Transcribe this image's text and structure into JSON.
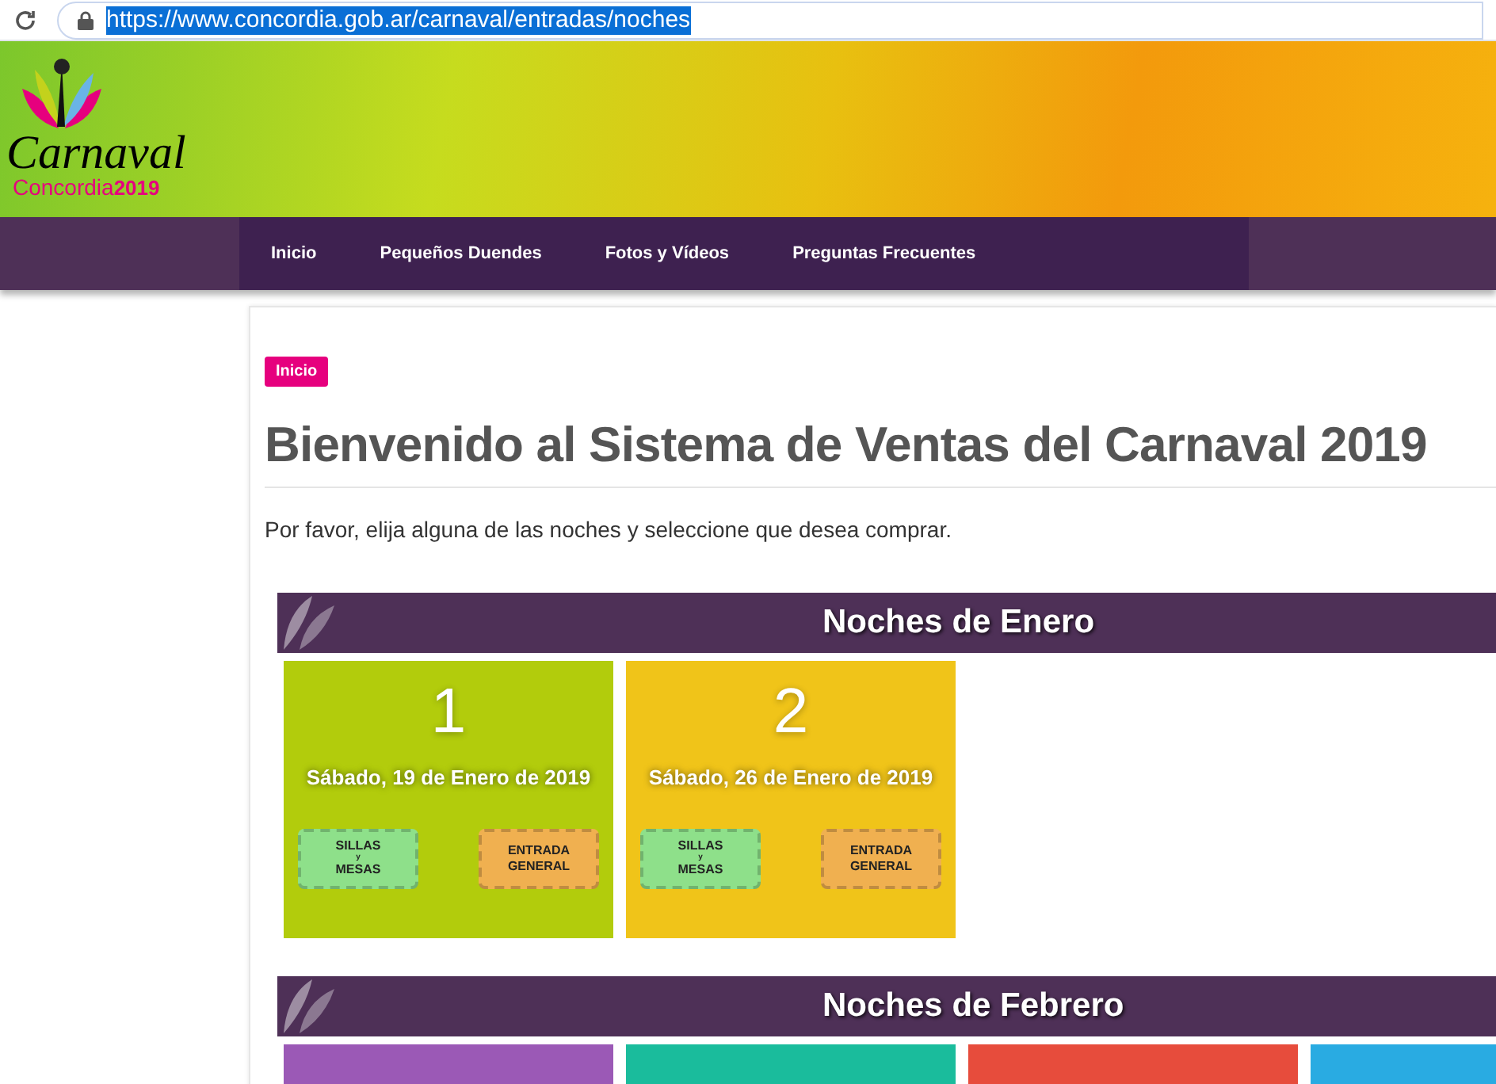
{
  "browser": {
    "url": "https://www.concordia.gob.ar/carnaval/entradas/noches"
  },
  "logo": {
    "title": "Carnaval",
    "subtitle": "Concordia",
    "year": "2019"
  },
  "nav": [
    {
      "label": "Inicio"
    },
    {
      "label": "Pequeños Duendes"
    },
    {
      "label": "Fotos y Vídeos"
    },
    {
      "label": "Preguntas Frecuentes"
    }
  ],
  "breadcrumb": "Inicio",
  "heading": "Bienvenido al Sistema de Ventas del Carnaval 2019",
  "intro": "Por favor, elija alguna de las noches y seleccione que desea comprar.",
  "months": [
    {
      "title": "Noches de Enero",
      "nights": [
        {
          "number": "1",
          "date": "Sábado, 19 de Enero de 2019",
          "color": "#b2cc0c",
          "tickets": [
            {
              "kind": "seats",
              "lines": [
                "SILLAS",
                "y",
                "MESAS"
              ]
            },
            {
              "kind": "general",
              "lines": [
                "ENTRADA",
                "GENERAL"
              ]
            }
          ]
        },
        {
          "number": "2",
          "date": "Sábado, 26 de Enero de 2019",
          "color": "#f0c419",
          "tickets": [
            {
              "kind": "seats",
              "lines": [
                "SILLAS",
                "y",
                "MESAS"
              ]
            },
            {
              "kind": "general",
              "lines": [
                "ENTRADA",
                "GENERAL"
              ]
            }
          ]
        }
      ]
    },
    {
      "title": "Noches de Febrero",
      "nights": [
        {
          "color": "#9b59b6"
        },
        {
          "color": "#1abc9c"
        },
        {
          "color": "#e74c3c"
        },
        {
          "color": "#29abe2"
        }
      ]
    }
  ]
}
